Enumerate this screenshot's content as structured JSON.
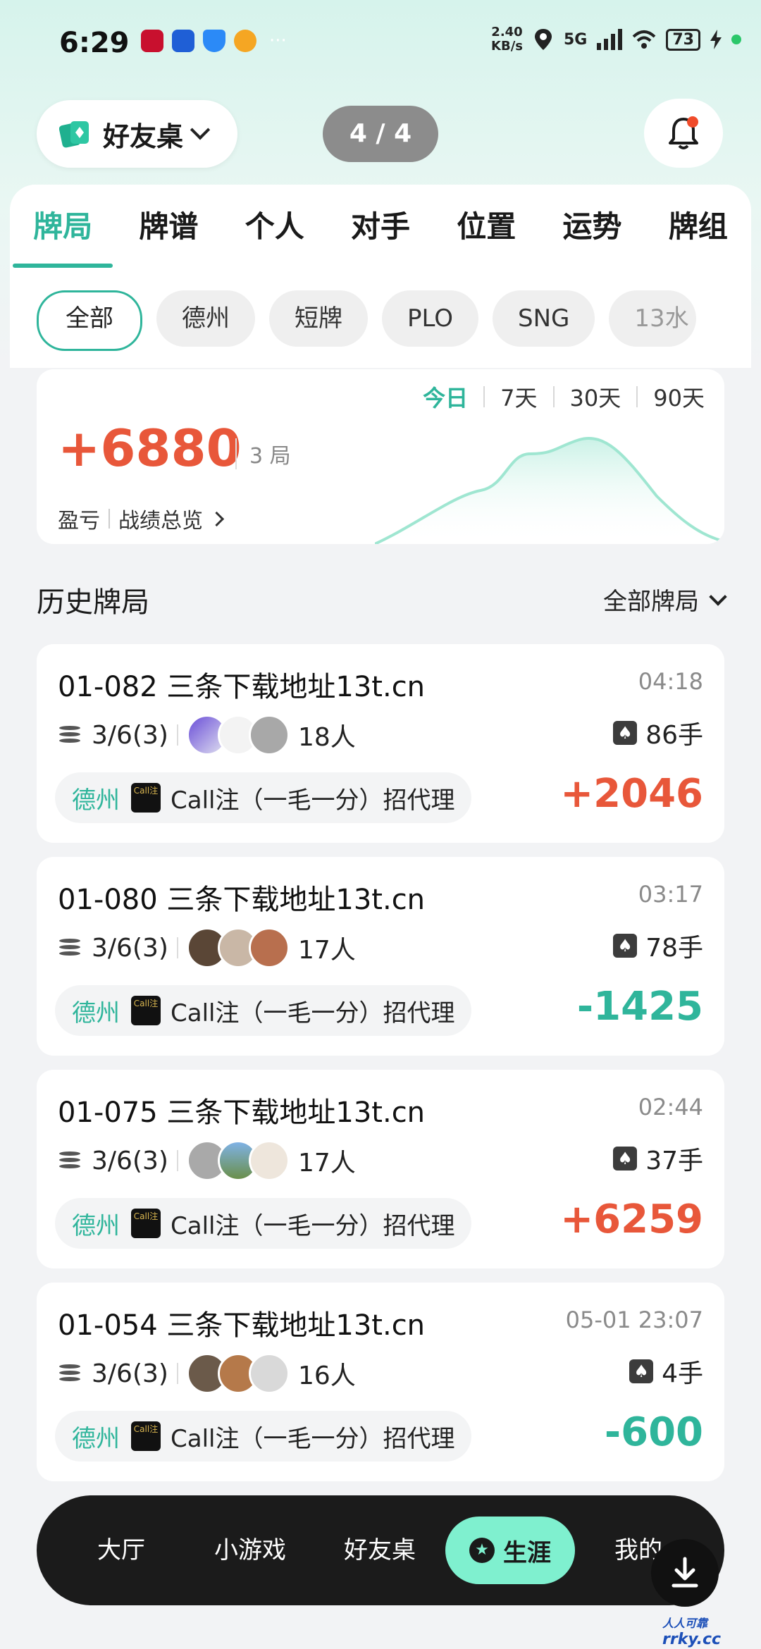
{
  "status_bar": {
    "time": "6:29",
    "net_speed_value": "2.40",
    "net_speed_unit": "KB/s",
    "signal": "5G",
    "battery": "73"
  },
  "header": {
    "friend_table_label": "好友桌",
    "page_indicator": "4 / 4"
  },
  "tabs": [
    {
      "label": "牌局",
      "active": true
    },
    {
      "label": "牌谱"
    },
    {
      "label": "个人"
    },
    {
      "label": "对手"
    },
    {
      "label": "位置"
    },
    {
      "label": "运势"
    },
    {
      "label": "牌组"
    }
  ],
  "chips": [
    {
      "label": "全部",
      "active": true
    },
    {
      "label": "德州"
    },
    {
      "label": "短牌"
    },
    {
      "label": "PLO"
    },
    {
      "label": "SNG"
    },
    {
      "label": "13水"
    }
  ],
  "stats": {
    "periods": [
      "今日",
      "7天",
      "30天",
      "90天"
    ],
    "active_period": "今日",
    "profit": "+6880",
    "games": "3 局",
    "profit_label": "盈亏",
    "overview_label": "战绩总览"
  },
  "history": {
    "title": "历史牌局",
    "filter_label": "全部牌局",
    "games": [
      {
        "title": "01-082 三条下载地址13t.cn",
        "time": "04:18",
        "blinds": "3/6(3)",
        "players": "18人",
        "hands": "86手",
        "type": "德州",
        "club": "Call注（一毛一分）招代理",
        "result": "+2046",
        "positive": true
      },
      {
        "title": "01-080 三条下载地址13t.cn",
        "time": "03:17",
        "blinds": "3/6(3)",
        "players": "17人",
        "hands": "78手",
        "type": "德州",
        "club": "Call注（一毛一分）招代理",
        "result": "-1425",
        "positive": false
      },
      {
        "title": "01-075 三条下载地址13t.cn",
        "time": "02:44",
        "blinds": "3/6(3)",
        "players": "17人",
        "hands": "37手",
        "type": "德州",
        "club": "Call注（一毛一分）招代理",
        "result": "+6259",
        "positive": true
      },
      {
        "title": "01-054 三条下载地址13t.cn",
        "time": "05-01 23:07",
        "blinds": "3/6(3)",
        "players": "16人",
        "hands": "4手",
        "type": "德州",
        "club": "Call注（一毛一分）招代理",
        "result": "-600",
        "positive": false
      }
    ]
  },
  "club_logo_text": "Call注",
  "bottom_nav": {
    "items": [
      "大厅",
      "小游戏",
      "好友桌",
      "生涯",
      "我的"
    ],
    "active": "生涯"
  },
  "watermark": {
    "line1": "人人可靠",
    "line2": "rrky.cc"
  },
  "colors": {
    "accent": "#2fb59b",
    "positive": "#e8573a",
    "negative": "#2fb59b",
    "nav_active": "#7ff0cf"
  }
}
